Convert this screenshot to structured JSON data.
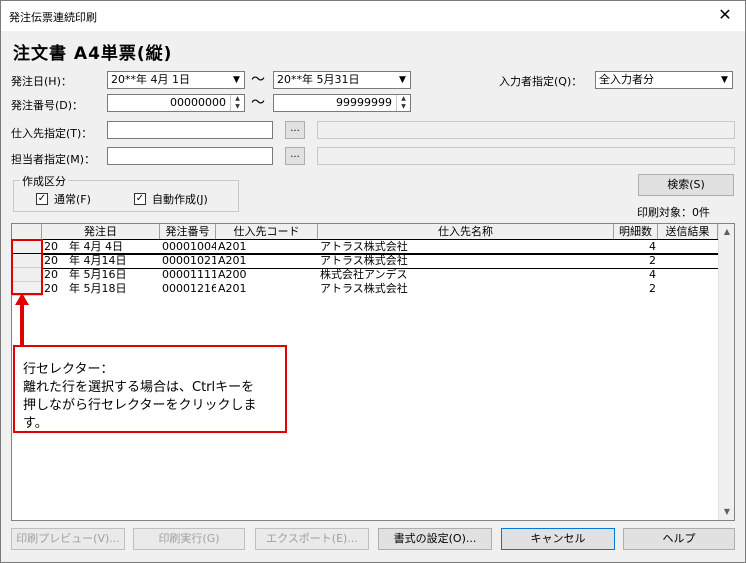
{
  "window": {
    "title": "発注伝票連続印刷",
    "close_glyph": "✕"
  },
  "heading": "注文書 A4単票(縦)",
  "filters": {
    "order_date_label": "発注日(H)：",
    "order_date_from": "20**年 4月 1日",
    "order_date_to": "20**年 5月31日",
    "order_no_label": "発注番号(D)：",
    "order_no_from": "00000000",
    "order_no_to": "99999999",
    "tilde": "～",
    "input_user_label": "入力者指定(Q)：",
    "input_user_value": "全入力者分",
    "supplier_label": "仕入先指定(T)：",
    "staff_label": "担当者指定(M)：",
    "browse_label": "..."
  },
  "creation_group": {
    "title": "作成区分",
    "normal_label": "通常(F)",
    "auto_label": "自動作成(J)",
    "check_glyph": "✓"
  },
  "search": {
    "button_label": "検索(S)",
    "print_target": "印刷対象：0件"
  },
  "table": {
    "columns": [
      "発注日",
      "発注番号",
      "仕入先コード",
      "仕入先名称",
      "明細数",
      "送信結果"
    ],
    "rows": [
      {
        "date": "20　年 4月 4日",
        "order_no": "00001004",
        "supplier_code": "A201",
        "supplier_name": "アトラス株式会社",
        "details": "4",
        "result": ""
      },
      {
        "date": "20　年 4月14日",
        "order_no": "00001021",
        "supplier_code": "A201",
        "supplier_name": "アトラス株式会社",
        "details": "2",
        "result": ""
      },
      {
        "date": "20　年 5月16日",
        "order_no": "00001111",
        "supplier_code": "A200",
        "supplier_name": "株式会社アンデス",
        "details": "4",
        "result": ""
      },
      {
        "date": "20　年 5月18日",
        "order_no": "00001216",
        "supplier_code": "A201",
        "supplier_name": "アトラス株式会社",
        "details": "2",
        "result": ""
      }
    ]
  },
  "callout": {
    "line1": "行セレクター：",
    "line2": "離れた行を選択する場合は、Ctrlキーを",
    "line3": "押しながら行セレクターをクリックします。"
  },
  "buttons": {
    "preview": "印刷プレビュー(V)...",
    "execute": "印刷実行(G)",
    "export": "エクスポート(E)...",
    "format": "書式の設定(O)...",
    "cancel": "キャンセル",
    "help": "ヘルプ"
  },
  "colors": {
    "highlight": "#e00000"
  }
}
